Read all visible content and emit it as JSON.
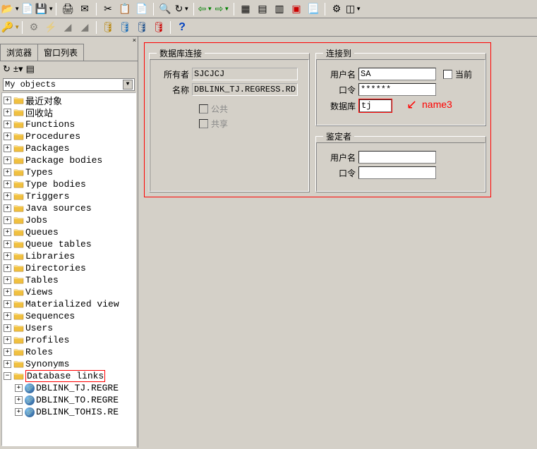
{
  "toolbar1": {
    "items": [
      "open",
      "new",
      "save",
      "print",
      "separator",
      "mail",
      "cut",
      "copy",
      "paste",
      "separator",
      "find",
      "redo",
      "separator",
      "back",
      "forward",
      "separator",
      "col",
      "row",
      "rows",
      "exec",
      "script",
      "settings",
      "filter"
    ]
  },
  "toolbar2": {
    "help": "?"
  },
  "leftPanel": {
    "tabs": {
      "browser": "浏览器",
      "windowList": "窗口列表"
    },
    "combo": "My objects",
    "tree": [
      {
        "label": "最近对象",
        "cn": true
      },
      {
        "label": "回收站",
        "cn": true
      },
      {
        "label": "Functions"
      },
      {
        "label": "Procedures"
      },
      {
        "label": "Packages"
      },
      {
        "label": "Package bodies"
      },
      {
        "label": "Types"
      },
      {
        "label": "Type bodies"
      },
      {
        "label": "Triggers"
      },
      {
        "label": "Java sources"
      },
      {
        "label": "Jobs"
      },
      {
        "label": "Queues"
      },
      {
        "label": "Queue tables"
      },
      {
        "label": "Libraries"
      },
      {
        "label": "Directories"
      },
      {
        "label": "Tables"
      },
      {
        "label": "Views"
      },
      {
        "label": "Materialized view"
      },
      {
        "label": "Sequences"
      },
      {
        "label": "Users"
      },
      {
        "label": "Profiles"
      },
      {
        "label": "Roles"
      },
      {
        "label": "Synonyms"
      },
      {
        "label": "Database links",
        "hl": true,
        "expanded": true
      }
    ],
    "dblinks": [
      "DBLINK_TJ.REGRE",
      "DBLINK_TO.REGRE",
      "DBLINK_TOHIS.RE"
    ]
  },
  "form": {
    "dbConn": {
      "legend": "数据库连接",
      "ownerLabel": "所有者",
      "owner": "SJCJCJ",
      "nameLabel": "名称",
      "name": "DBLINK_TJ.REGRESS.RDBMS.D",
      "publicLabel": "公共",
      "shareLabel": "共享"
    },
    "connectTo": {
      "legend": "连接到",
      "userLabel": "用户名",
      "user": "SA",
      "pwdLabel": "口令",
      "pwd": "******",
      "dbLabel": "数据库",
      "db": "tj",
      "currentLabel": "当前"
    },
    "auth": {
      "legend": "鉴定者",
      "userLabel": "用户名",
      "user": "",
      "pwdLabel": "口令",
      "pwd": ""
    }
  },
  "annotation": {
    "text": "name3"
  }
}
